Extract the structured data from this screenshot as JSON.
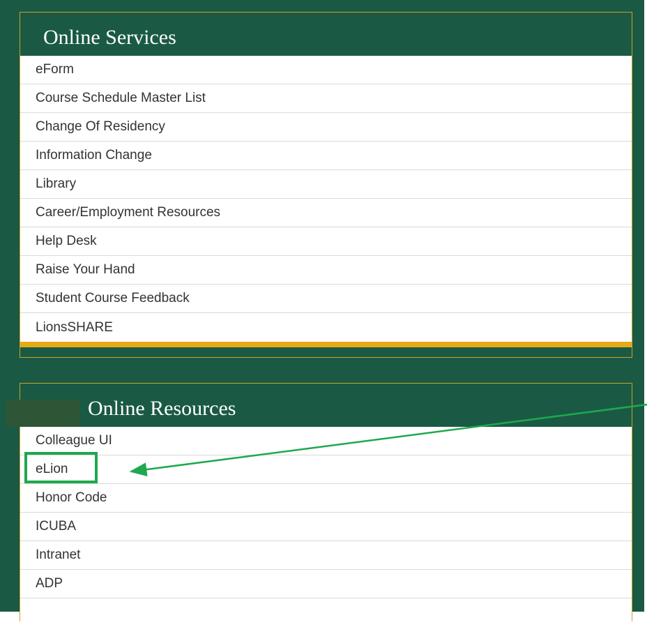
{
  "sections": [
    {
      "title": "Online Services",
      "items": [
        "eForm",
        "Course Schedule Master List",
        "Change Of Residency",
        "Information Change",
        "Library",
        "Career/Employment Resources",
        "Help Desk",
        "Raise Your Hand",
        "Student Course Feedback",
        "LionsSHARE"
      ]
    },
    {
      "title": "Online Resources",
      "items": [
        "Colleague UI",
        "eLion",
        "Honor Code",
        "ICUBA",
        "Intranet",
        "ADP"
      ]
    }
  ],
  "colors": {
    "background_green": "#1a5a44",
    "gold_border": "#c9a227",
    "annotation_green": "#1fa84f"
  },
  "annotation": {
    "highlighted_item": "eLion",
    "icon": "arrow-annotation-icon"
  }
}
